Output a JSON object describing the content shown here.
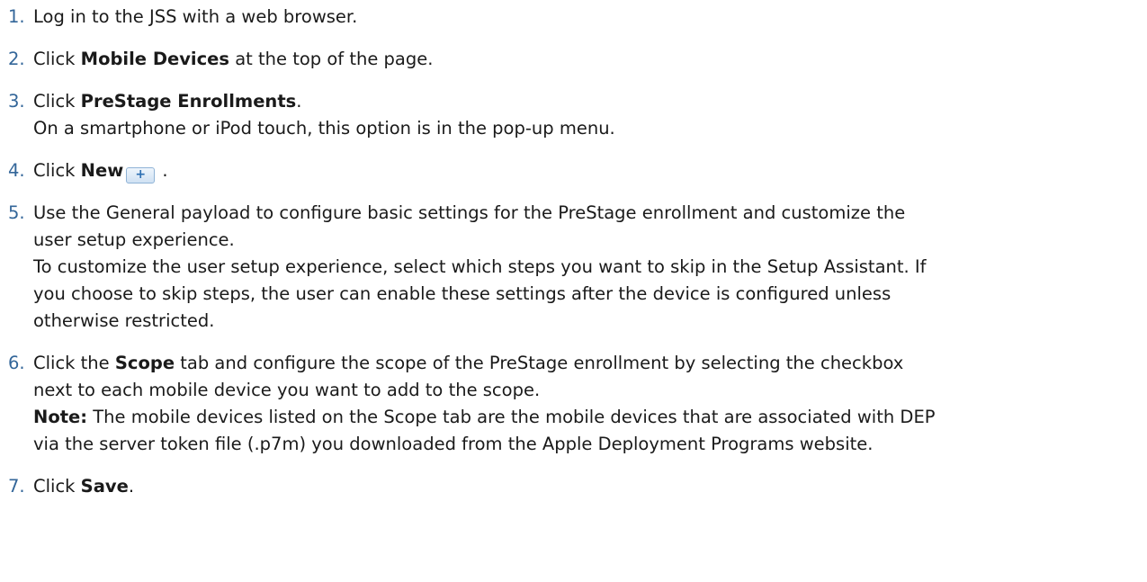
{
  "steps": [
    {
      "num": "1.",
      "text": "Log in to the JSS with a web browser."
    },
    {
      "num": "2.",
      "pre": "Click ",
      "bold": "Mobile Devices",
      "post": " at the top of the page."
    },
    {
      "num": "3.",
      "pre": "Click ",
      "bold": "PreStage Enrollments",
      "post": ".",
      "sub": "On a smartphone or iPod touch, this option is in the pop-up menu."
    },
    {
      "num": "4.",
      "pre": "Click ",
      "bold": "New",
      "icon": "plus-button-icon",
      "icon_glyph": "+",
      "post": " ."
    },
    {
      "num": "5.",
      "line1": "Use the General payload to configure basic settings for the PreStage enrollment and customize the",
      "line2": "user setup experience.",
      "sub1": "To customize the user setup experience, select which steps you want to skip in the Setup Assistant. If",
      "sub2": "you choose to skip steps, the user can enable these settings after the device is configured unless",
      "sub3": "otherwise restricted."
    },
    {
      "num": "6.",
      "pre": "Click the ",
      "bold": "Scope",
      "post": " tab and configure the scope of the PreStage enrollment by selecting the checkbox",
      "line2": "next to each mobile device you want to add to the scope.",
      "note_label": "Note:",
      "note1": " The mobile devices listed on the Scope tab are the mobile devices that are associated with DEP",
      "note2": "via the server token file (.p7m) you downloaded from the Apple Deployment Programs website."
    },
    {
      "num": "7.",
      "pre": "Click ",
      "bold": "Save",
      "post": "."
    }
  ]
}
